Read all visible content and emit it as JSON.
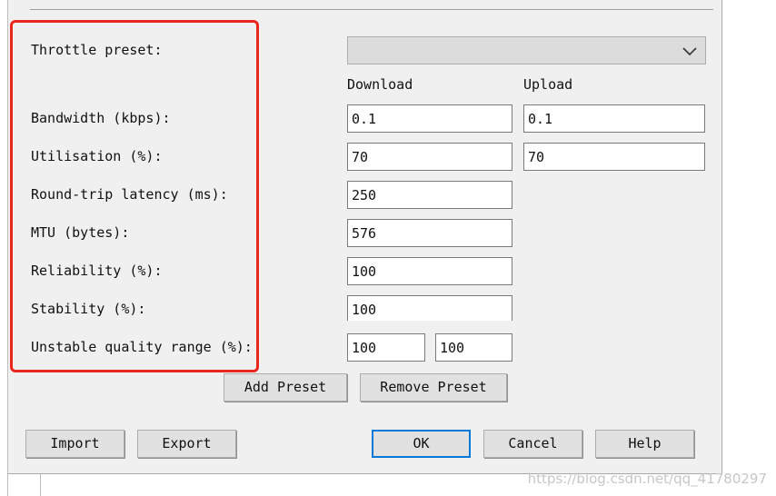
{
  "dialog": {
    "preset_label": "Throttle preset:",
    "preset_value": "",
    "col_download": "Download",
    "col_upload": "Upload",
    "rows": {
      "bandwidth": {
        "label": "Bandwidth (kbps):",
        "download": "0.1",
        "upload": "0.1"
      },
      "utilisation": {
        "label": "Utilisation (%):",
        "download": "70",
        "upload": "70"
      },
      "latency": {
        "label": "Round-trip latency (ms):",
        "value": "250"
      },
      "mtu": {
        "label": "MTU (bytes):",
        "value": "576"
      },
      "reliability": {
        "label": "Reliability (%):",
        "value": "100"
      },
      "stability": {
        "label": "Stability (%):",
        "value": "100"
      },
      "unstable": {
        "label": "Unstable quality range (%):",
        "min": "100",
        "max": "100"
      }
    },
    "buttons": {
      "add_preset": "Add Preset",
      "remove_preset": "Remove Preset",
      "import": "Import",
      "export": "Export",
      "ok": "OK",
      "cancel": "Cancel",
      "help": "Help"
    }
  },
  "watermark": "https://blog.csdn.net/qq_41780297",
  "colors": {
    "highlight": "#e8261c",
    "default_button_border": "#0078d7"
  }
}
